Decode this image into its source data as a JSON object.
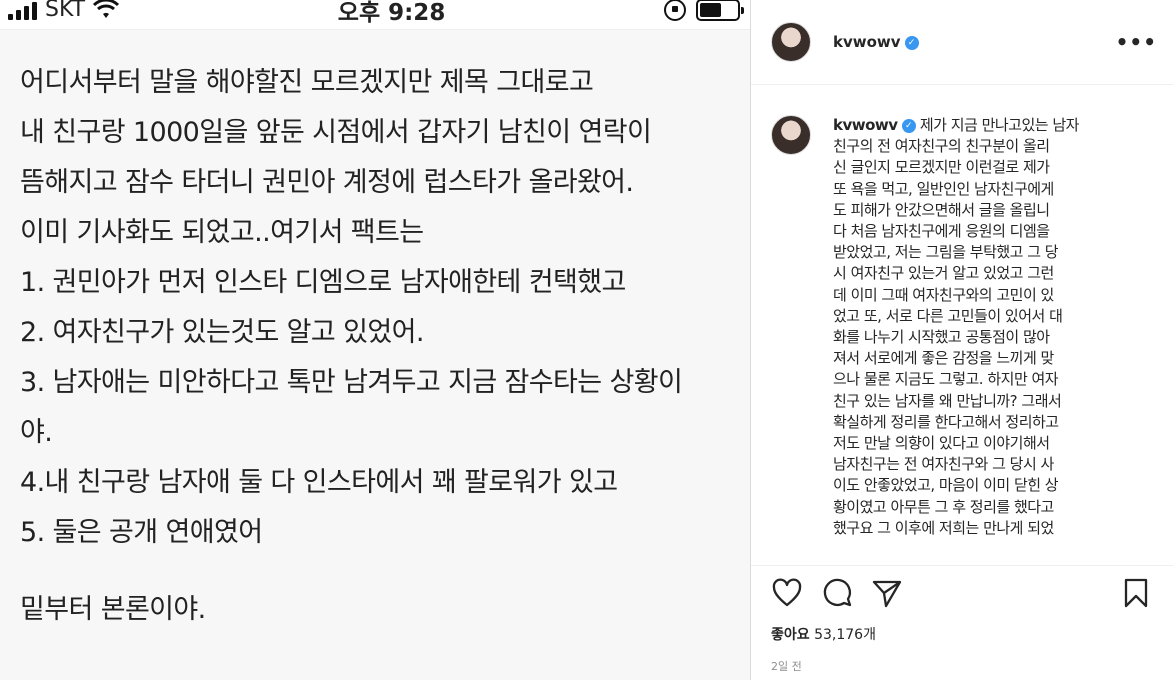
{
  "status_bar": {
    "carrier": "SKT",
    "time": "오후 9:28"
  },
  "post_text": {
    "lines": [
      "어디서부터 말을 해야할진 모르겠지만 제목 그대로고",
      "내 친구랑 1000일을 앞둔 시점에서 갑자기 남친이 연락이",
      "뜸해지고 잠수 타더니 권민아 계정에 럽스타가 올라왔어.",
      "이미 기사화도 되었고..여기서 팩트는",
      "1. 권민아가 먼저 인스타 디엠으로 남자애한테 컨택했고",
      "2. 여자친구가 있는것도 알고 있었어.",
      "3. 남자애는 미안하다고 톡만 남겨두고 지금 잠수타는 상황이",
      "야.",
      "4.내 친구랑 남자애 둘 다 인스타에서 꽤 팔로워가 있고",
      "5. 둘은 공개 연애였어"
    ],
    "footer": "밑부터 본론이야."
  },
  "instagram": {
    "username": "kvwowv",
    "more_label": "•••",
    "caption_lines": [
      "제가 지금 만나고있는 남자",
      "친구의 전 여자친구의 친구분이 올리",
      "신 글인지 모르겠지만 이런걸로 제가",
      "또 욕을 먹고, 일반인인 남자친구에게",
      "도 피해가 안갔으면해서 글을 올립니",
      "다 처음 남자친구에게 응원의 디엠을",
      "받았었고, 저는 그림을 부탁했고 그 당",
      "시 여자친구 있는거 알고 있었고 그런",
      "데 이미 그때 여자친구와의 고민이 있",
      "었고 또, 서로 다른 고민들이 있어서 대",
      "화를 나누기 시작했고 공통점이 많아",
      "져서 서로에게 좋은 감정을 느끼게 맞",
      "으나 물론 지금도 그렇고. 하지만 여자",
      "친구 있는 남자를 왜 만납니까? 그래서",
      "확실하게 정리를 한다고해서 정리하고",
      "저도 만날 의향이 있다고 이야기해서",
      "남자친구는 전 여자친구와 그 당시 사",
      "이도 안좋았었고, 마음이 이미 닫힌 상",
      "황이였고 아무튼 그 후 정리를 했다고",
      "했구요 그 이후에 저희는 만나게 되었"
    ],
    "likes_label": "좋아요",
    "likes_count": "53,176개",
    "timestamp": "2일 전"
  },
  "icons": {
    "like": "heart-icon",
    "comment": "comment-icon",
    "share": "share-icon",
    "save": "bookmark-icon",
    "verified": "verified-badge-icon"
  },
  "colors": {
    "verified": "#3897f0",
    "text": "#262626",
    "muted": "#8e8e8e"
  }
}
